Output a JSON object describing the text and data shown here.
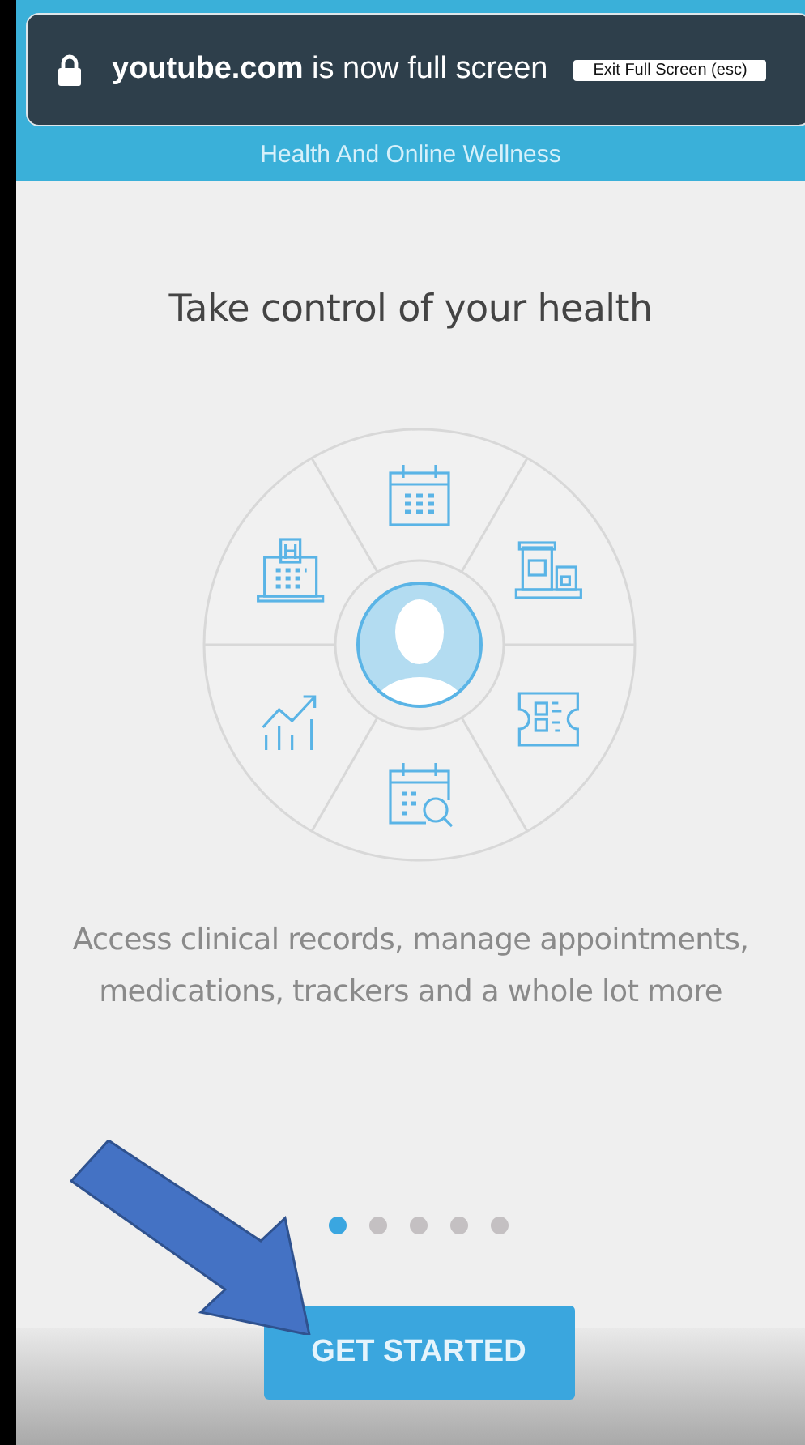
{
  "fullscreen_banner": {
    "message": "**youtube.com** is now full screen",
    "exit_button": "Exit Full Screen (esc)"
  },
  "header": {
    "tagline": "Health And Online Wellness"
  },
  "headline": "Take control of your health",
  "description": "Access clinical records, manage appointments, medications, trackers and a whole lot more",
  "pager_dots": [
    {
      "selected": true
    },
    {
      "selected": false
    },
    {
      "selected": false
    },
    {
      "selected": false
    },
    {
      "selected": false
    }
  ],
  "primary_button": "GET STARTED"
}
